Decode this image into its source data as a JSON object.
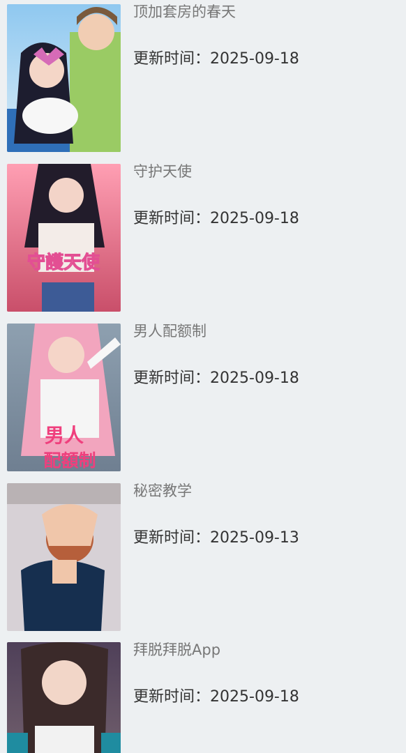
{
  "items": [
    {
      "title": "顶加套房的春天",
      "update_label": "更新时间：",
      "update_date": "2025-09-18"
    },
    {
      "title": "守护天使",
      "update_label": "更新时间：",
      "update_date": "2025-09-18",
      "cover_text": "守護天使"
    },
    {
      "title": "男人配额制",
      "update_label": "更新时间：",
      "update_date": "2025-09-18",
      "cover_text_1": "男人",
      "cover_text_2": "配額制"
    },
    {
      "title": "秘密教学",
      "update_label": "更新时间：",
      "update_date": "2025-09-13"
    },
    {
      "title": "拜脱拜脱App",
      "update_label": "更新时间：",
      "update_date": "2025-09-18"
    }
  ]
}
